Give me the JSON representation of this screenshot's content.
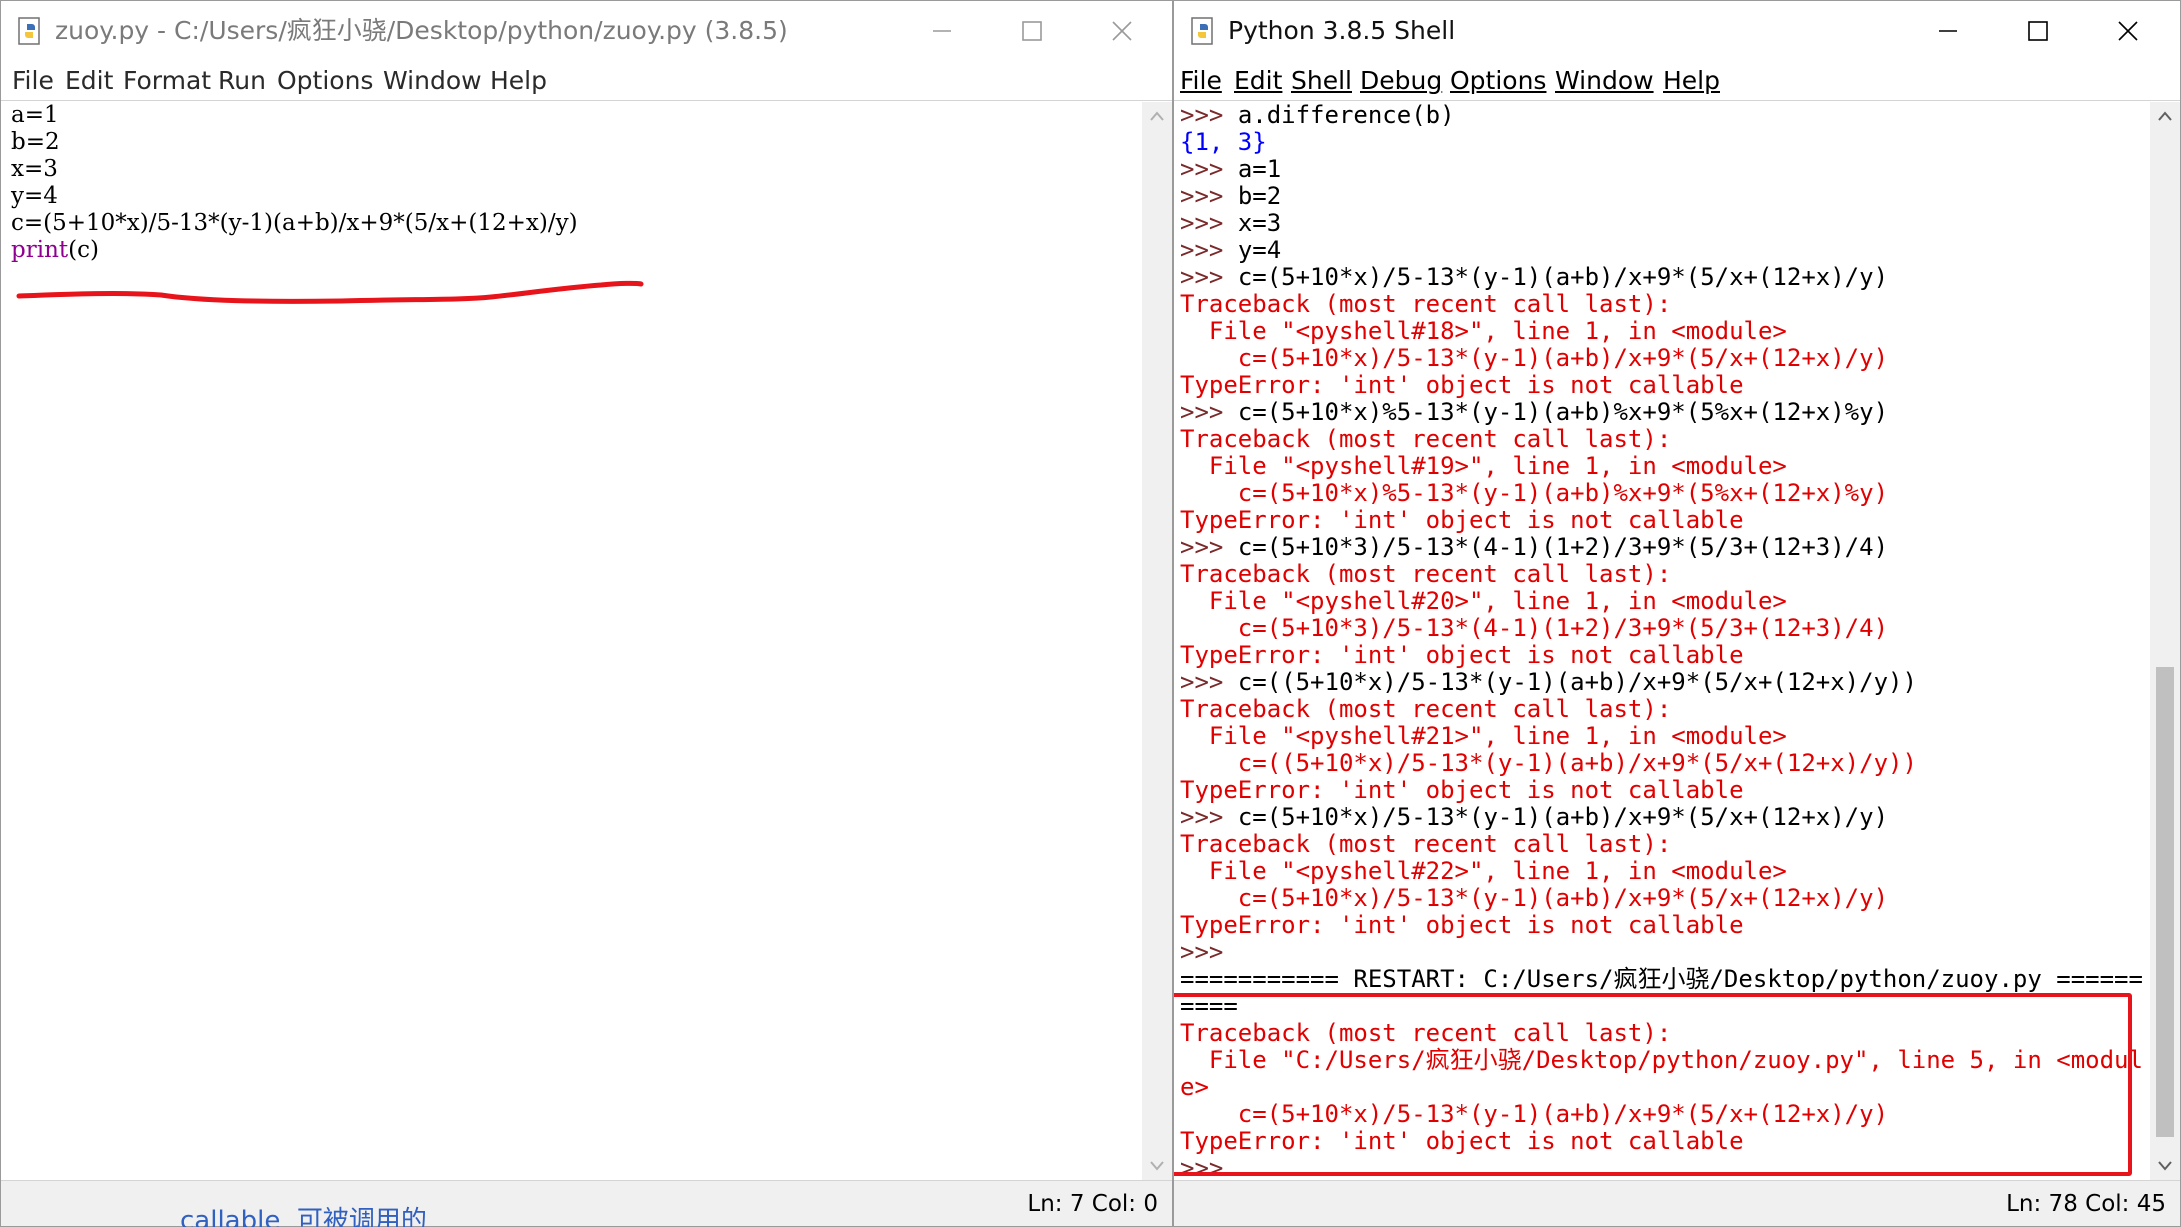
{
  "editor": {
    "title": "zuoy.py - C:/Users/疯狂小骁/Desktop/python/zuoy.py (3.8.5)",
    "menu": [
      "File",
      "Edit",
      "Format",
      "Run",
      "Options",
      "Window",
      "Help"
    ],
    "code": {
      "line1": "a=1",
      "line2": "b=2",
      "line3": "x=3",
      "line4": "y=4",
      "line5": "c=(5+10*x)/5-13*(y-1)(a+b)/x+9*(5/x+(12+x)/y)",
      "line6_builtin": "print",
      "line6_rest": "(c)"
    },
    "status": "Ln: 7  Col: 0"
  },
  "shell": {
    "title": "Python 3.8.5 Shell",
    "menu": [
      "File",
      "Edit",
      "Shell",
      "Debug",
      "Options",
      "Window",
      "Help"
    ],
    "prompt": ">>>",
    "lines": {
      "l01": "a.difference(b)",
      "l02": "{1, 3}",
      "l03": "a=1",
      "l04": "b=2",
      "l05": "x=3",
      "l06": "y=4",
      "l07": "c=(5+10*x)/5-13*(y-1)(a+b)/x+9*(5/x+(12+x)/y)",
      "l08": "Traceback (most recent call last):",
      "l09": "  File \"<pyshell#18>\", line 1, in <module>",
      "l10": "    c=(5+10*x)/5-13*(y-1)(a+b)/x+9*(5/x+(12+x)/y)",
      "l11": "TypeError: 'int' object is not callable",
      "l12": "c=(5+10*x)%5-13*(y-1)(a+b)%x+9*(5%x+(12+x)%y)",
      "l13": "Traceback (most recent call last):",
      "l14": "  File \"<pyshell#19>\", line 1, in <module>",
      "l15": "    c=(5+10*x)%5-13*(y-1)(a+b)%x+9*(5%x+(12+x)%y)",
      "l16": "TypeError: 'int' object is not callable",
      "l17": "c=(5+10*3)/5-13*(4-1)(1+2)/3+9*(5/3+(12+3)/4)",
      "l18": "Traceback (most recent call last):",
      "l19": "  File \"<pyshell#20>\", line 1, in <module>",
      "l20": "    c=(5+10*3)/5-13*(4-1)(1+2)/3+9*(5/3+(12+3)/4)",
      "l21": "TypeError: 'int' object is not callable",
      "l22": "c=((5+10*x)/5-13*(y-1)(a+b)/x+9*(5/x+(12+x)/y))",
      "l23": "Traceback (most recent call last):",
      "l24": "  File \"<pyshell#21>\", line 1, in <module>",
      "l25": "    c=((5+10*x)/5-13*(y-1)(a+b)/x+9*(5/x+(12+x)/y))",
      "l26": "TypeError: 'int' object is not callable",
      "l27": "c=(5+10*x)/5-13*(y-1)(a+b)/x+9*(5/x+(12+x)/y)",
      "l28": "Traceback (most recent call last):",
      "l29": "  File \"<pyshell#22>\", line 1, in <module>",
      "l30": "    c=(5+10*x)/5-13*(y-1)(a+b)/x+9*(5/x+(12+x)/y)",
      "l31": "TypeError: 'int' object is not callable",
      "l33": "=========== RESTART: C:/Users/疯狂小骁/Desktop/python/zuoy.py ======",
      "l34": "====",
      "l35": "Traceback (most recent call last):",
      "l36": "  File \"C:/Users/疯狂小骁/Desktop/python/zuoy.py\", line 5, in <modul",
      "l37": "e>",
      "l38": "    c=(5+10*x)/5-13*(y-1)(a+b)/x+9*(5/x+(12+x)/y)",
      "l39": "TypeError: 'int' object is not callable"
    },
    "status": "Ln: 78  Col: 45"
  },
  "background": {
    "partial_text": "callable  可被调用的"
  },
  "colors": {
    "error_red": "#e00000",
    "output_blue": "#0000ff",
    "builtin_purple": "#900090",
    "annotation_red": "#e8141b"
  }
}
